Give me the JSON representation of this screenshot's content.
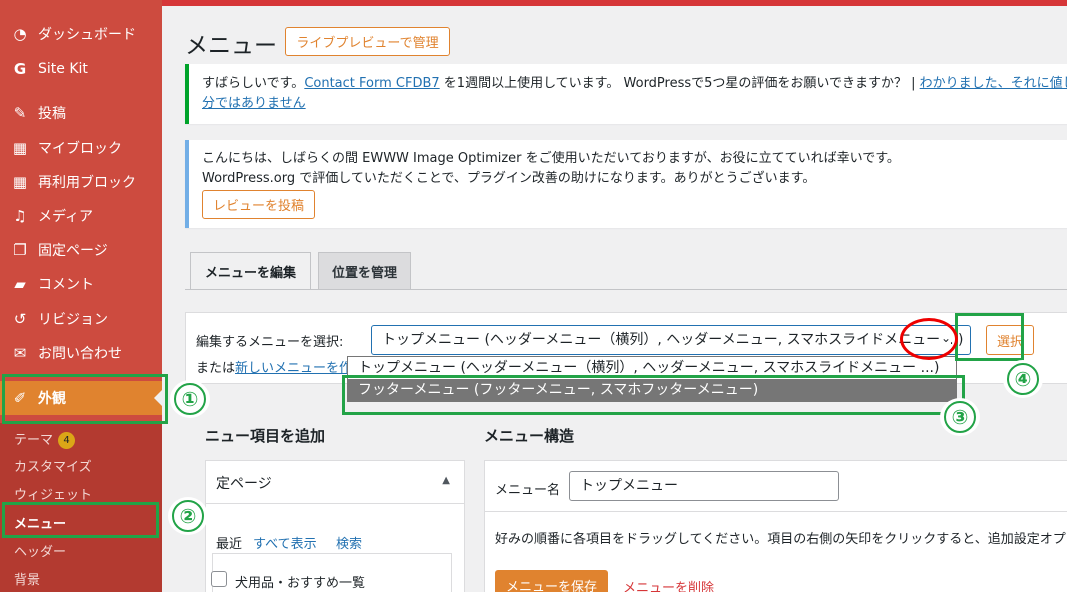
{
  "sidebar": {
    "items": [
      {
        "label": "ダッシュボード",
        "icon": "dashboard-icon",
        "glyph": "◔"
      },
      {
        "label": "Site Kit",
        "icon": "google-g-icon",
        "glyph": "G"
      },
      {
        "label": "投稿",
        "icon": "pin-icon",
        "glyph": "✎"
      },
      {
        "label": "マイブロック",
        "icon": "blocks-icon",
        "glyph": "▦"
      },
      {
        "label": "再利用ブロック",
        "icon": "reusable-blocks-icon",
        "glyph": "▦"
      },
      {
        "label": "メディア",
        "icon": "media-icon",
        "glyph": "♫"
      },
      {
        "label": "固定ページ",
        "icon": "pages-icon",
        "glyph": "❐"
      },
      {
        "label": "コメント",
        "icon": "comment-icon",
        "glyph": "▰"
      },
      {
        "label": "リビジョン",
        "icon": "revisions-icon",
        "glyph": "↺"
      },
      {
        "label": "お問い合わせ",
        "icon": "mail-icon",
        "glyph": "✉"
      },
      {
        "label": "外観",
        "icon": "appearance-brush-icon",
        "glyph": "✐"
      }
    ],
    "submenu": [
      {
        "label": "テーマ",
        "badge": "4"
      },
      {
        "label": "カスタマイズ"
      },
      {
        "label": "ウィジェット"
      },
      {
        "label": "メニュー"
      },
      {
        "label": "ヘッダー"
      },
      {
        "label": "背景"
      }
    ]
  },
  "page": {
    "title": "メニュー",
    "live_preview_button": "ライブプレビューで管理"
  },
  "notice1": {
    "text_before": "すばらしいです。",
    "link": "Contact Form CFDB7",
    "text_after": " を1週間以上使用しています。 WordPressで5つ星の評価をお願いできますか？ | ",
    "link2": "わかりました、それに値します",
    "link3": "分ではありません"
  },
  "notice2": {
    "line1": "こんにちは、しばらくの間 EWWW Image Optimizer をご使用いただいておりますが、お役に立てていれば幸いです。",
    "line2": "WordPress.org で評価していただくことで、プラグイン改善の助けになります。ありがとうございます。",
    "button": "レビューを投稿"
  },
  "tabs": [
    {
      "label": "メニューを編集"
    },
    {
      "label": "位置を管理"
    }
  ],
  "menu_select": {
    "label": "編集するメニューを選択:",
    "selected": "トップメニュー (ヘッダーメニュー（横列）, ヘッダーメニュー, スマホスライドメニュー ...)",
    "select_button": "選択",
    "or_text": "または",
    "new_menu_link": "新しいメニューを作",
    "options": [
      "トップメニュー (ヘッダーメニュー（横列）, ヘッダーメニュー, スマホスライドメニュー ...)",
      "フッターメニュー (フッターメニュー, スマホフッターメニュー)"
    ]
  },
  "annotations": [
    "①",
    "②",
    "③",
    "④"
  ],
  "add_items": {
    "heading": "ニュー項目を追加",
    "section": "定ページ",
    "tabs": [
      "最近",
      "すべて表示",
      "検索"
    ],
    "item": "犬用品・おすすめ一覧"
  },
  "structure": {
    "heading": "メニュー構造",
    "name_label": "メニュー名",
    "name_value": "トップメニュー",
    "instructions": "好みの順番に各項目をドラッグしてください。項目の右側の矢印をクリックすると、追加設定オプ",
    "save_button": "メニューを保存",
    "delete_link": "メニューを削除"
  },
  "colors": {
    "sidebar": "#cd4b3f",
    "active": "#e0832f",
    "annotation_green": "#22a347",
    "annotation_red": "#e00000"
  }
}
